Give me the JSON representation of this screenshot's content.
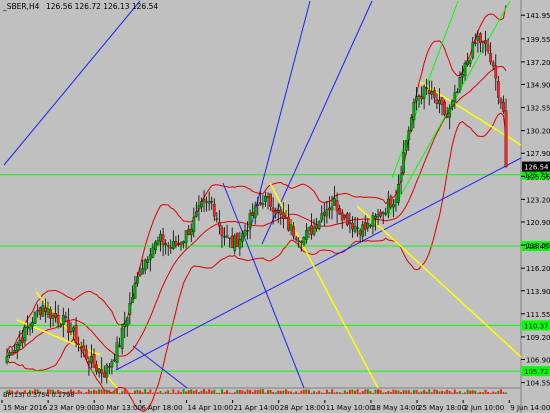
{
  "window": {
    "title": "_SBER,H4",
    "ohlc": "126.56 126.72 126.13 126.54",
    "indicator_label": "BP(13) 0.3754 0.1798"
  },
  "colors": {
    "background": "#c0c0c0",
    "bull": "#00aa00",
    "bear": "#ff2020",
    "bollinger": "#e00000",
    "level": "#00ff00",
    "trend_blue": "#2020ff",
    "channel_yellow": "#ffff00",
    "price_tag": "#000000"
  },
  "chart_data": {
    "type": "candlestick",
    "symbol": "_SBER",
    "timeframe": "H4",
    "current_price": "126.54",
    "x_labels": [
      "15 Mar 2016",
      "23 Mar 09:00",
      "30 Mar 13:00",
      "6 Apr 18:00",
      "14 Apr 10:00",
      "21 Apr 14:00",
      "28 Apr 18:00",
      "11 May 10:00",
      "18 May 14:00",
      "25 May 18:00",
      "2 Jun 10:00",
      "9 Jun 14:00"
    ],
    "y_ticks": [
      "141.95",
      "139.55",
      "137.20",
      "134.90",
      "132.55",
      "130.20",
      "127.90",
      "125.55",
      "123.20",
      "120.90",
      "118.55",
      "116.20",
      "113.90",
      "111.55",
      "109.20",
      "106.90",
      "104.55"
    ],
    "y_range": [
      104.0,
      143.5
    ],
    "horizontal_levels": [
      "125.71",
      "118.45",
      "110.37",
      "105.72"
    ],
    "price_path": [
      [
        0,
        107.2
      ],
      [
        6,
        109.2
      ],
      [
        10,
        111.0
      ],
      [
        14,
        112.4
      ],
      [
        18,
        111.3
      ],
      [
        22,
        110.8
      ],
      [
        26,
        109.5
      ],
      [
        30,
        107.6
      ],
      [
        34,
        106.2
      ],
      [
        38,
        105.6
      ],
      [
        40,
        106.3
      ],
      [
        44,
        108.6
      ],
      [
        48,
        112.5
      ],
      [
        52,
        116.0
      ],
      [
        56,
        118.2
      ],
      [
        60,
        119.0
      ],
      [
        64,
        118.3
      ],
      [
        68,
        118.9
      ],
      [
        72,
        120.5
      ],
      [
        76,
        122.4
      ],
      [
        80,
        122.9
      ],
      [
        84,
        119.9
      ],
      [
        88,
        118.6
      ],
      [
        92,
        119.6
      ],
      [
        96,
        121.6
      ],
      [
        100,
        123.3
      ],
      [
        104,
        122.6
      ],
      [
        108,
        121.0
      ],
      [
        112,
        119.9
      ],
      [
        116,
        119.3
      ],
      [
        120,
        120.4
      ],
      [
        124,
        122.2
      ],
      [
        128,
        122.9
      ],
      [
        132,
        121.4
      ],
      [
        136,
        120.5
      ],
      [
        140,
        120.2
      ],
      [
        144,
        121.2
      ],
      [
        148,
        122.4
      ],
      [
        152,
        123.6
      ],
      [
        156,
        129.3
      ],
      [
        160,
        133.6
      ],
      [
        164,
        134.3
      ],
      [
        168,
        133.0
      ],
      [
        172,
        131.6
      ],
      [
        176,
        134.1
      ],
      [
        180,
        137.4
      ],
      [
        184,
        139.6
      ],
      [
        188,
        138.3
      ],
      [
        192,
        134.2
      ],
      [
        194,
        132.2
      ],
      [
        195,
        126.5
      ]
    ]
  }
}
